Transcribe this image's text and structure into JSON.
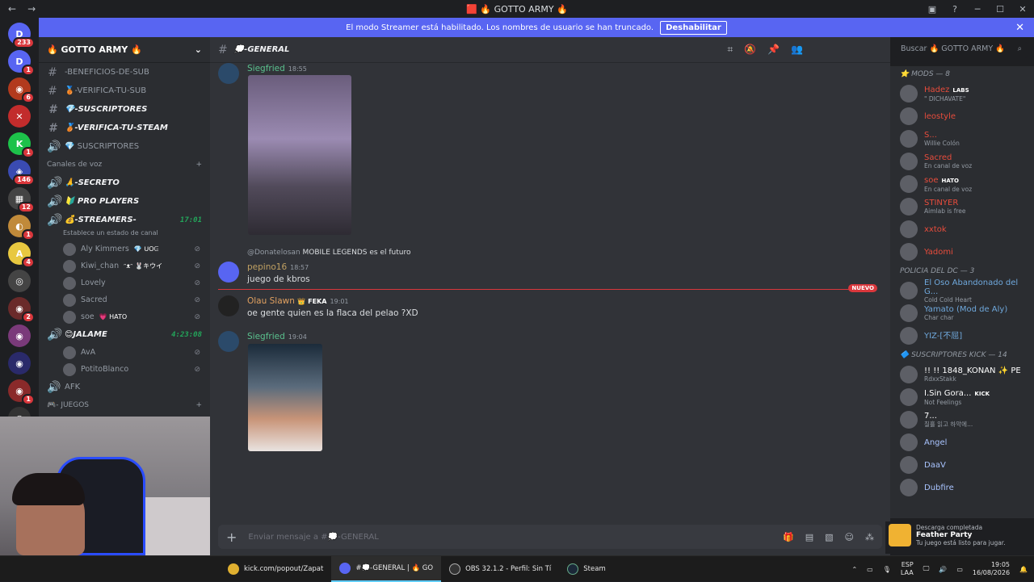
{
  "window": {
    "title": "🟥 🔥 GOTTO ARMY 🔥",
    "nav": [
      "←",
      "→"
    ],
    "controls": [
      "▣",
      "?",
      "─",
      "☐",
      "✕"
    ]
  },
  "banner": {
    "text": "El modo Streamer está habilitado. Los nombres de usuario se han truncado.",
    "button": "Deshabilitar",
    "close": "✕"
  },
  "servers": [
    {
      "label": "D",
      "badge": "233",
      "color": "#5865f2"
    },
    {
      "label": "D",
      "badge": "1",
      "color": "#5865f2"
    },
    {
      "label": "◉",
      "badge": "6",
      "color": "#b23a1d"
    },
    {
      "label": "✕",
      "badge": "",
      "color": "#c22c2c"
    },
    {
      "label": "K",
      "badge": "1",
      "color": "#1dc24a"
    },
    {
      "label": "◈",
      "badge": "146",
      "color": "#3a4bb2"
    },
    {
      "label": "▦",
      "badge": "12",
      "color": "#444"
    },
    {
      "label": "◐",
      "badge": "1",
      "color": "#c08a3a"
    },
    {
      "label": "A",
      "badge": "4",
      "color": "#e8c840"
    },
    {
      "label": "◎",
      "badge": "",
      "color": "#444"
    },
    {
      "label": "◉",
      "badge": "2",
      "color": "#6a2a2a"
    },
    {
      "label": "◉",
      "badge": "",
      "color": "#7a3a7a"
    },
    {
      "label": "◉",
      "badge": "",
      "color": "#2a2a6a"
    },
    {
      "label": "◉",
      "badge": "1",
      "color": "#8a2a2a"
    },
    {
      "label": "◉",
      "badge": "177",
      "color": "#333"
    }
  ],
  "guild": {
    "name": "🔥 GOTTO ARMY 🔥"
  },
  "channels": {
    "text": [
      {
        "icon": "#",
        "name": "-BENEFICIOS-DE-SUB",
        "bold": false
      },
      {
        "icon": "#",
        "name": "🥉-VERIFICA-TU-SUB",
        "bold": false
      },
      {
        "icon": "#",
        "name": "💎-SUSCRIPTORES",
        "bold": true
      },
      {
        "icon": "#",
        "name": "🥉-VERIFICA-TU-STEAM",
        "bold": true
      },
      {
        "icon": "🔊",
        "name": "💎 SUSCRIPTORES",
        "bold": false
      }
    ],
    "voice_category": "Canales de voz",
    "voice": [
      {
        "name": "🙏-SECRETO"
      },
      {
        "name": "🔰 PRO PLAYERS"
      },
      {
        "name": "💰-STREAMERS-",
        "time": "17:01",
        "status": "Establece un estado de canal"
      }
    ],
    "streamers_users": [
      {
        "name": "Aly Kimmers",
        "tag": "💎 ᑌOᕮ"
      },
      {
        "name": "Kiwi_chan",
        "tag": "ᵔᴥᵔ 🐰キウイ"
      },
      {
        "name": "Lovely",
        "tag": ""
      },
      {
        "name": "Sacred",
        "tag": ""
      },
      {
        "name": "soe",
        "tag": "💗 HATO"
      }
    ],
    "jalame": {
      "name": "😊JALAME",
      "time": "4:23:08"
    },
    "jalame_users": [
      {
        "name": "AvA"
      },
      {
        "name": "PotitoBlanco"
      }
    ],
    "afk": "AFK",
    "juegos": "🎮- JUEGOS"
  },
  "chat": {
    "channel": "💭-GENERAL",
    "messages": [
      {
        "user": "Siegfried",
        "time": "18:55",
        "color": "#5ac18e",
        "text": ""
      },
      {
        "reply_user": "@Donatelosan",
        "reply_text": "MOBILE LEGENDS es el futuro",
        "user": "pepino16",
        "time": "18:57",
        "color": "#c0a062",
        "text": "juego de kbros"
      },
      {
        "user": "Olau Slawn",
        "badge": "👑 FEKA",
        "time": "19:01",
        "color": "#e0a060",
        "text": "oe gente quien es la flaca del pelao ?XD"
      },
      {
        "user": "Siegfried",
        "time": "19:04",
        "color": "#5ac18e",
        "text": ""
      }
    ],
    "new_label": "NUEVO",
    "input_placeholder": "Enviar mensaje a #💭-GENERAL",
    "search_placeholder": "Buscar 🔥 GOTTO ARMY 🔥"
  },
  "members": {
    "mods_label": "⭐ MODS — 8",
    "mods": [
      {
        "name": "Hadez",
        "tag": "LABS",
        "status": "\" DICHAVATE\"",
        "color": "#e74c3c"
      },
      {
        "name": "leostyle",
        "status": "",
        "color": "#e74c3c"
      },
      {
        "name": "S...",
        "status": "Willie Colón",
        "color": "#e74c3c"
      },
      {
        "name": "Sacred",
        "status": "En canal de voz",
        "color": "#e74c3c"
      },
      {
        "name": "soe",
        "tag": "HATO",
        "status": "En canal de voz",
        "color": "#e74c3c"
      },
      {
        "name": "STINYER",
        "status": "Aimlab is free",
        "color": "#e74c3c"
      },
      {
        "name": "xxtok",
        "status": "",
        "color": "#e74c3c"
      },
      {
        "name": "Yadomi",
        "status": "",
        "color": "#e74c3c"
      }
    ],
    "police_label": "POLICIA DEL DC — 3",
    "police": [
      {
        "name": "El Oso Abandonado del G...",
        "status": "Cold Cold Heart",
        "color": "#6fa8dc"
      },
      {
        "name": "Yamato (Mod de Aly)",
        "status": "Char char",
        "color": "#6fa8dc"
      },
      {
        "name": "YIZ-[不屈]",
        "status": "",
        "color": "#6fa8dc"
      }
    ],
    "kick_label": "🔷 SUSCRIPTORES KICK — 14",
    "kick": [
      {
        "name": "!! !! 1848_KONAN ✨ PE",
        "status": "RdxxStakk",
        "color": "#ffffff"
      },
      {
        "name": "I.Sin Gora...",
        "tag": "KICK",
        "status": "Not Feelings",
        "color": "#ffffff"
      },
      {
        "name": "7...",
        "status": "칠흘 읽고 하악에...",
        "color": "#ffffff"
      },
      {
        "name": "Angel",
        "status": "",
        "color": "#a9c4ff"
      },
      {
        "name": "DaaV",
        "status": "",
        "color": "#a9c4ff"
      },
      {
        "name": "Dubfire",
        "status": "",
        "color": "#a9c4ff"
      }
    ]
  },
  "toast": {
    "title": "Descarga completada",
    "app": "Feather Party",
    "text": "Tu juego está listo para jugar."
  },
  "taskbar": {
    "apps": [
      {
        "label": "kick.com/popout/Zapat",
        "active": false
      },
      {
        "label": "#💭-GENERAL | 🔥 GO",
        "active": true
      },
      {
        "label": "OBS 32.1.2 - Perfil: Sin Tí",
        "active": false
      },
      {
        "label": "Steam",
        "active": false
      }
    ],
    "lang": "ESP",
    "lang2": "LAA",
    "time": "19:05",
    "date": "16/08/2026"
  }
}
